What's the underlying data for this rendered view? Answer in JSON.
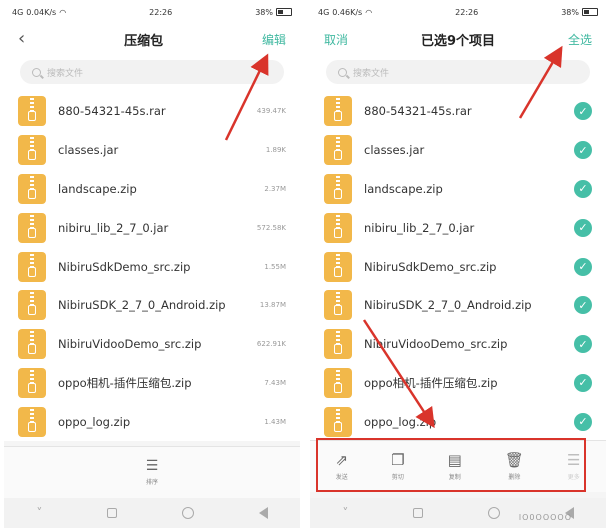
{
  "left": {
    "status": {
      "signal": "4G",
      "speed": "0.04K/s",
      "time": "22:26",
      "battery": "38%"
    },
    "title": "压缩包",
    "action": "编辑",
    "back_icon": "back-arrow-icon",
    "search_placeholder": "搜索文件",
    "files": [
      {
        "name": "880-54321-45s.rar",
        "size": "439.47K"
      },
      {
        "name": "classes.jar",
        "size": "1.89K"
      },
      {
        "name": "landscape.zip",
        "size": "2.37M"
      },
      {
        "name": "nibiru_lib_2_7_0.jar",
        "size": "572.58K"
      },
      {
        "name": "NibiruSdkDemo_src.zip",
        "size": "1.55M"
      },
      {
        "name": "NibiruSDK_2_7_0_Android.zip",
        "size": "13.87M"
      },
      {
        "name": "NibiruVidooDemo_src.zip",
        "size": "622.91K"
      },
      {
        "name": "oppo相机-插件压缩包.zip",
        "size": "7.43M"
      },
      {
        "name": "oppo_log.zip",
        "size": "1.43M"
      }
    ],
    "sort_label": "排序"
  },
  "right": {
    "status": {
      "signal": "4G",
      "speed": "0.46K/s",
      "time": "22:26",
      "battery": "38%"
    },
    "cancel": "取消",
    "title": "已选9个项目",
    "select_all": "全选",
    "search_placeholder": "搜索文件",
    "files": [
      {
        "name": "880-54321-45s.rar"
      },
      {
        "name": "classes.jar"
      },
      {
        "name": "landscape.zip"
      },
      {
        "name": "nibiru_lib_2_7_0.jar"
      },
      {
        "name": "NibiruSdkDemo_src.zip"
      },
      {
        "name": "NibiruSDK_2_7_0_Android.zip"
      },
      {
        "name": "NibiruVidooDemo_src.zip"
      },
      {
        "name": "oppo相机-插件压缩包.zip"
      },
      {
        "name": "oppo_log.zip"
      }
    ],
    "actions": [
      {
        "label": "发送",
        "icon": "share-icon"
      },
      {
        "label": "剪切",
        "icon": "cut-icon"
      },
      {
        "label": "复制",
        "icon": "copy-icon"
      },
      {
        "label": "删除",
        "icon": "trash-icon"
      },
      {
        "label": "更多",
        "icon": "more-icon"
      }
    ]
  },
  "watermark": "lO0OOOOO",
  "colors": {
    "accent": "#3fb8a0",
    "zip": "#f2b84a",
    "check": "#46bfa7",
    "annotation": "#d9342b"
  }
}
